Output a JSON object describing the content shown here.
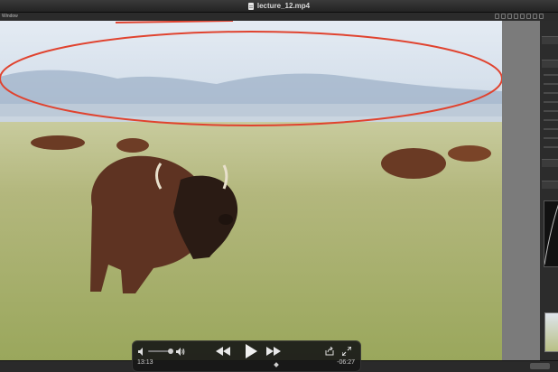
{
  "window": {
    "title": "lecture_12.mp4",
    "app_toolbar_label": "Window"
  },
  "player": {
    "elapsed": "13:13",
    "remaining": "-06:27",
    "colors": {
      "hud_bg": "#161616",
      "annotation": "#e0432f"
    }
  },
  "icons": [
    "file-icon",
    "volume-low-icon",
    "volume-high-icon",
    "rewind-icon",
    "play-icon",
    "fast-forward-icon",
    "share-icon",
    "fullscreen-icon"
  ]
}
